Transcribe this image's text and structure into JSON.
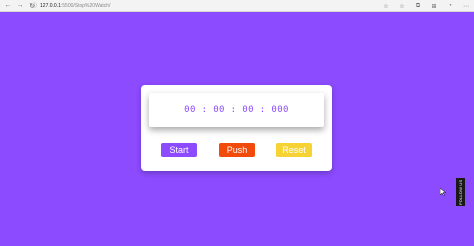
{
  "browser": {
    "url_host": "127.0.0.1",
    "url_path": ":5500/Stop%20Watch/",
    "nav": {
      "back": "←",
      "forward": "→",
      "reload": "↻",
      "info": "ⓘ"
    },
    "toolbar_icons": [
      "☆",
      "☆",
      "⧉",
      "⊞",
      "◔",
      "⋯"
    ]
  },
  "stopwatch": {
    "display": "00 : 00 : 00 : 000",
    "buttons": {
      "start": "Start",
      "push": "Push",
      "reset": "Reset"
    }
  },
  "colors": {
    "background": "#8c4bff",
    "start": "#8c4bff",
    "push": "#f24a0b",
    "reset": "#f6d235",
    "display_text": "#8c4bff"
  },
  "side_tab": {
    "label": "FOLLOW US"
  }
}
